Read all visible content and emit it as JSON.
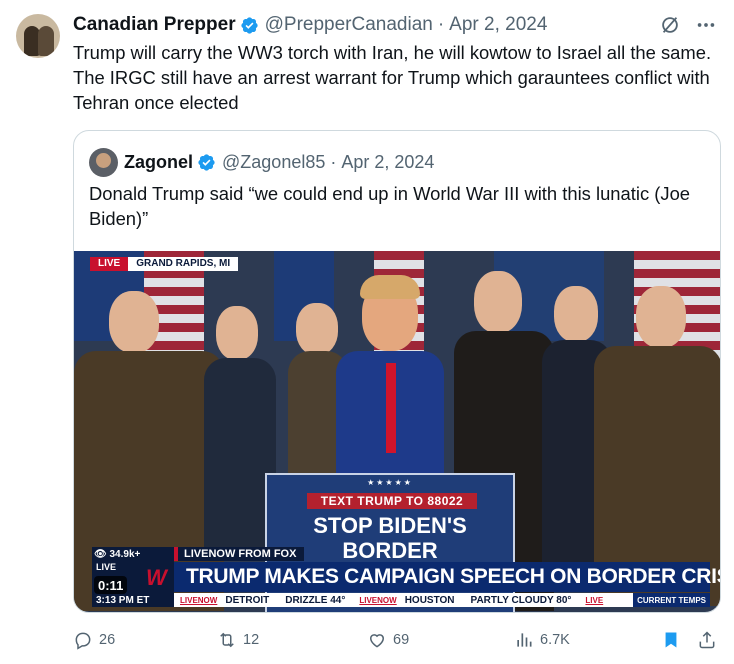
{
  "tweet": {
    "author_name": "Canadian Prepper",
    "handle": "@PrepperCanadian",
    "separator": "·",
    "date": "Apr 2, 2024",
    "text": "Trump will carry the WW3 torch with Iran, he will kowtow to Israel all the same. The IRGC still have an arrest warrant for Trump which garauntees conflict with Tehran once elected"
  },
  "quote": {
    "author_name": "Zagonel",
    "handle": "@Zagonel85",
    "separator": "·",
    "date": "Apr 2, 2024",
    "text": "Donald Trump said “we could end up in World War III with this lunatic (Joe Biden)”",
    "video": {
      "live_tag": "LIVE",
      "location": "GRAND RAPIDS, MI",
      "podium_text_line": "TEXT TRUMP TO 88022",
      "podium_big_1": "STOP BIDEN'S",
      "podium_big_2": "BORDER",
      "podium_stars": "★★★★★",
      "viewers": "34.9k+",
      "live_small": "LIVE",
      "network_mark": "W",
      "time_elapsed": "0:11",
      "clock": "3:13 PM ET",
      "chyron_top": "LIVENOW FROM FOX",
      "chyron_main": "TRUMP MAKES CAMPAIGN SPEECH ON BORDER CRISIS",
      "ticker": [
        {
          "brand": "LIVENOW",
          "city": "DETROIT",
          "weather": "DRIZZLE 44°"
        },
        {
          "brand": "LIVENOW",
          "city": "HOUSTON",
          "weather": "PARTLY CLOUDY 80°"
        }
      ],
      "ticker_end_brand": "LIVE",
      "ticker_end": "CURRENT TEMPS"
    }
  },
  "actions": {
    "replies": "26",
    "reposts": "12",
    "likes": "69",
    "views": "6.7K"
  },
  "colors": {
    "verified": "#1d9bf0",
    "muted": "#536471",
    "bookmark": "#1d9bf0"
  }
}
